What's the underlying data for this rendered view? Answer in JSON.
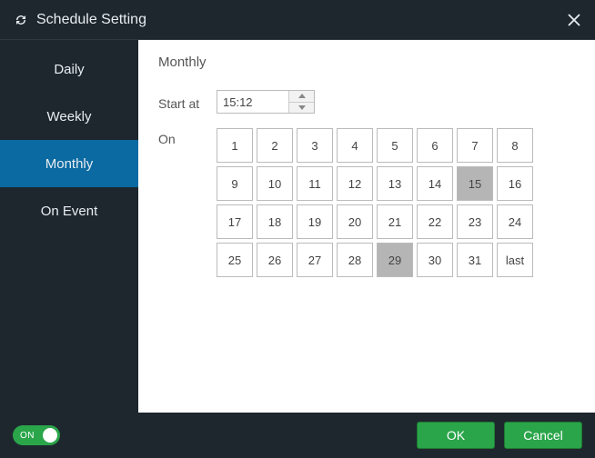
{
  "title": "Schedule Setting",
  "sidebar": {
    "tabs": [
      {
        "label": "Daily",
        "active": false
      },
      {
        "label": "Weekly",
        "active": false
      },
      {
        "label": "Monthly",
        "active": true
      },
      {
        "label": "On Event",
        "active": false
      }
    ]
  },
  "panel": {
    "heading": "Monthly",
    "start_label": "Start at",
    "start_time": "15:12",
    "on_label": "On",
    "days": [
      {
        "label": "1",
        "selected": false
      },
      {
        "label": "2",
        "selected": false
      },
      {
        "label": "3",
        "selected": false
      },
      {
        "label": "4",
        "selected": false
      },
      {
        "label": "5",
        "selected": false
      },
      {
        "label": "6",
        "selected": false
      },
      {
        "label": "7",
        "selected": false
      },
      {
        "label": "8",
        "selected": false
      },
      {
        "label": "9",
        "selected": false
      },
      {
        "label": "10",
        "selected": false
      },
      {
        "label": "11",
        "selected": false
      },
      {
        "label": "12",
        "selected": false
      },
      {
        "label": "13",
        "selected": false
      },
      {
        "label": "14",
        "selected": false
      },
      {
        "label": "15",
        "selected": true
      },
      {
        "label": "16",
        "selected": false
      },
      {
        "label": "17",
        "selected": false
      },
      {
        "label": "18",
        "selected": false
      },
      {
        "label": "19",
        "selected": false
      },
      {
        "label": "20",
        "selected": false
      },
      {
        "label": "21",
        "selected": false
      },
      {
        "label": "22",
        "selected": false
      },
      {
        "label": "23",
        "selected": false
      },
      {
        "label": "24",
        "selected": false
      },
      {
        "label": "25",
        "selected": false
      },
      {
        "label": "26",
        "selected": false
      },
      {
        "label": "27",
        "selected": false
      },
      {
        "label": "28",
        "selected": false
      },
      {
        "label": "29",
        "selected": true
      },
      {
        "label": "30",
        "selected": false
      },
      {
        "label": "31",
        "selected": false
      },
      {
        "label": "last",
        "selected": false
      }
    ]
  },
  "footer": {
    "toggle_label": "ON",
    "toggle_state": true,
    "ok": "OK",
    "cancel": "Cancel"
  }
}
